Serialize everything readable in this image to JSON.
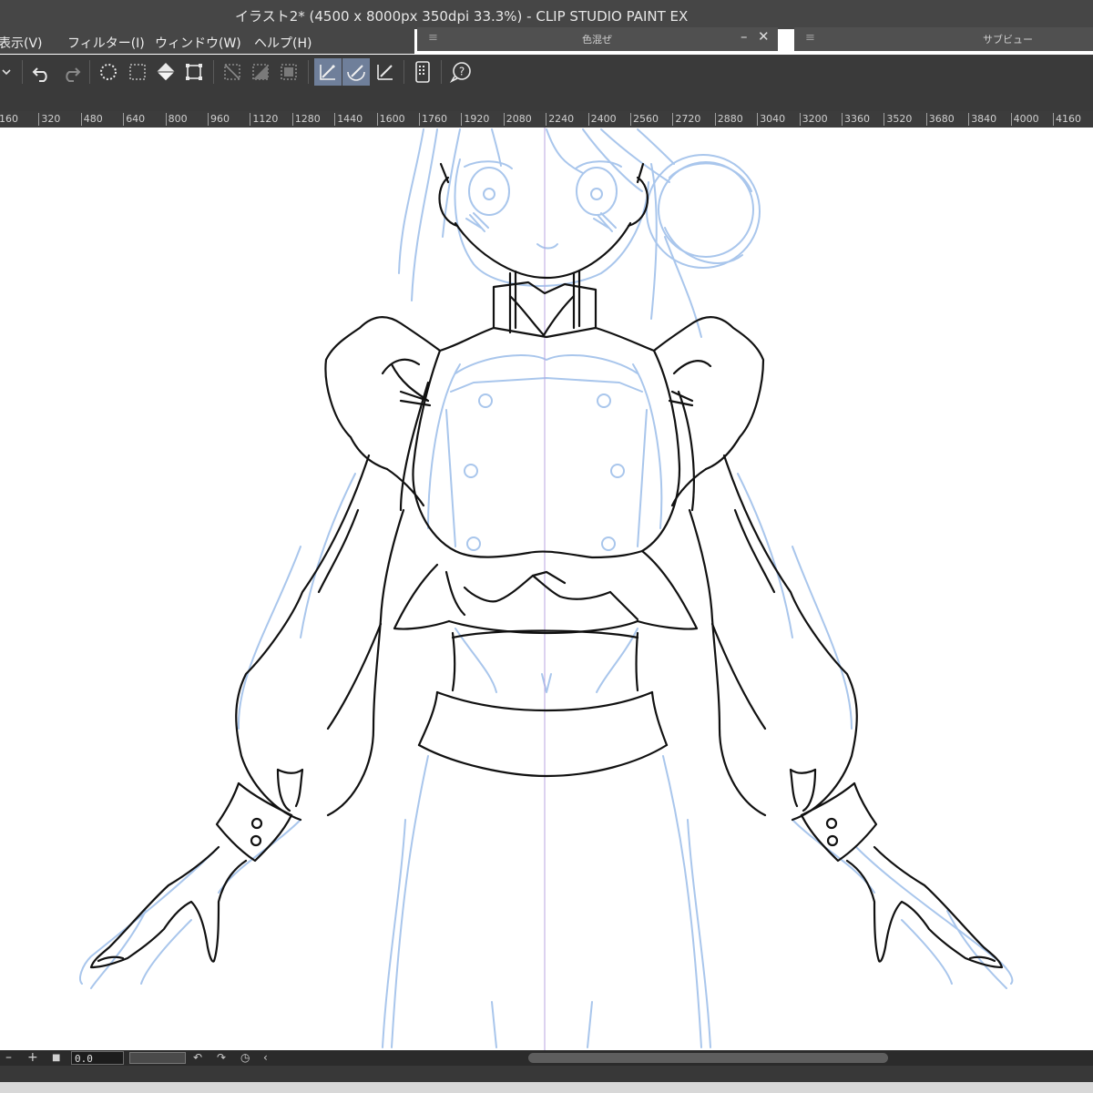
{
  "window": {
    "title": "イラスト2* (4500 x 8000px 350dpi 33.3%)  - CLIP STUDIO PAINT EX"
  },
  "menu": {
    "items": [
      "表示(V)",
      "フィルター(I)",
      "ウィンドウ(W)",
      "ヘルプ(H)"
    ]
  },
  "panels": {
    "color_mixing": {
      "title": "色混ぜ",
      "minimize": "–",
      "close": "✕"
    },
    "sub_view": {
      "title": "サブビュー"
    }
  },
  "toolbar": {
    "icons": [
      "dropdown-icon",
      "undo-icon",
      "redo-icon",
      "clear-icon",
      "fill-icon",
      "transform-icon",
      "deselect-icon",
      "invert-selection-icon",
      "selection-border-icon",
      "ruler-snap-icon",
      "special-ruler-snap-icon",
      "grid-snap-icon",
      "device-icon",
      "help-icon"
    ],
    "active": [
      "ruler-snap-icon",
      "special-ruler-snap-icon"
    ]
  },
  "ruler": {
    "labels": [
      "160",
      "320",
      "480",
      "640",
      "800",
      "960",
      "1120",
      "1280",
      "1440",
      "1600",
      "1760",
      "1920",
      "2080",
      "2240",
      "2400",
      "2560",
      "2720",
      "2880",
      "3040",
      "3200",
      "3360",
      "3520",
      "3680",
      "3840",
      "4000",
      "4160"
    ]
  },
  "bottom_bar": {
    "minus": "–",
    "plus": "+",
    "rotation_value": "0.0"
  },
  "colors": {
    "sketch_blue": "#a9c6ec",
    "line_art": "#111111",
    "guide_line": "#b9a6e0",
    "active_tool_bg": "#6f7f9a"
  }
}
